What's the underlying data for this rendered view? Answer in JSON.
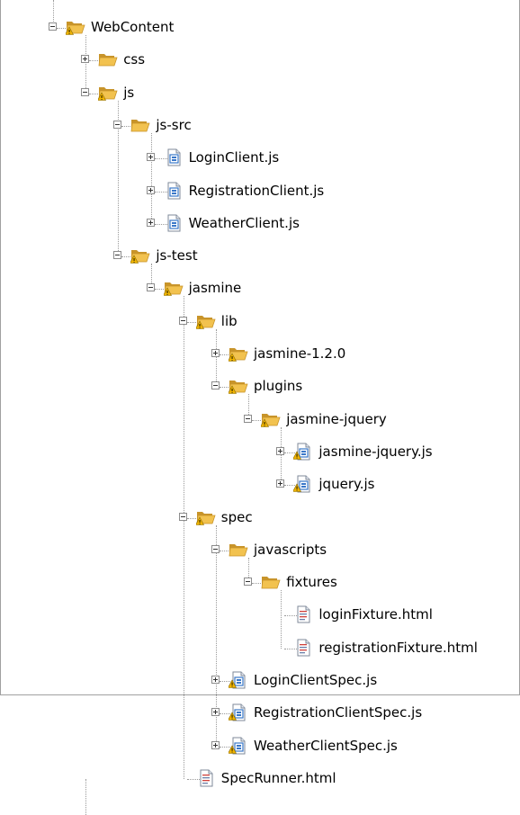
{
  "tree": [
    {
      "label": "WebContent",
      "depth": 0,
      "type": "project-folder",
      "expander": "minus"
    },
    {
      "label": "css",
      "depth": 1,
      "type": "folder",
      "expander": "plus"
    },
    {
      "label": "js",
      "depth": 1,
      "type": "project-folder",
      "expander": "minus"
    },
    {
      "label": "js-src",
      "depth": 2,
      "type": "folder",
      "expander": "minus"
    },
    {
      "label": "LoginClient.js",
      "depth": 3,
      "type": "js-file",
      "expander": "plus"
    },
    {
      "label": "RegistrationClient.js",
      "depth": 3,
      "type": "js-file",
      "expander": "plus"
    },
    {
      "label": "WeatherClient.js",
      "depth": 3,
      "type": "js-file",
      "expander": "plus"
    },
    {
      "label": "js-test",
      "depth": 2,
      "type": "project-folder",
      "expander": "minus"
    },
    {
      "label": "jasmine",
      "depth": 3,
      "type": "project-folder",
      "expander": "minus"
    },
    {
      "label": "lib",
      "depth": 4,
      "type": "project-folder",
      "expander": "minus"
    },
    {
      "label": "jasmine-1.2.0",
      "depth": 5,
      "type": "project-folder",
      "expander": "plus"
    },
    {
      "label": "plugins",
      "depth": 5,
      "type": "project-folder",
      "expander": "minus"
    },
    {
      "label": "jasmine-jquery",
      "depth": 6,
      "type": "project-folder",
      "expander": "minus"
    },
    {
      "label": "jasmine-jquery.js",
      "depth": 7,
      "type": "js-file-warning",
      "expander": "plus"
    },
    {
      "label": "jquery.js",
      "depth": 7,
      "type": "js-file-warning",
      "expander": "plus"
    },
    {
      "label": "spec",
      "depth": 4,
      "type": "project-folder",
      "expander": "minus"
    },
    {
      "label": "javascripts",
      "depth": 5,
      "type": "folder",
      "expander": "minus"
    },
    {
      "label": "fixtures",
      "depth": 6,
      "type": "folder",
      "expander": "minus"
    },
    {
      "label": "loginFixture.html",
      "depth": 7,
      "type": "html-file",
      "expander": "none"
    },
    {
      "label": "registrationFixture.html",
      "depth": 7,
      "type": "html-file",
      "expander": "none"
    },
    {
      "label": "LoginClientSpec.js",
      "depth": 5,
      "type": "js-file-warning",
      "expander": "plus"
    },
    {
      "label": "RegistrationClientSpec.js",
      "depth": 5,
      "type": "js-file-warning",
      "expander": "plus"
    },
    {
      "label": "WeatherClientSpec.js",
      "depth": 5,
      "type": "js-file-warning",
      "expander": "plus"
    },
    {
      "label": "SpecRunner.html",
      "depth": 4,
      "type": "html-file",
      "expander": "none"
    }
  ],
  "colors": {
    "folder": "#f2c24f",
    "folder_dark": "#c8942a",
    "warning": "#f0b400",
    "js_blue": "#3a78c9",
    "html_red": "#d0403a",
    "guide": "#9a9a9a"
  }
}
